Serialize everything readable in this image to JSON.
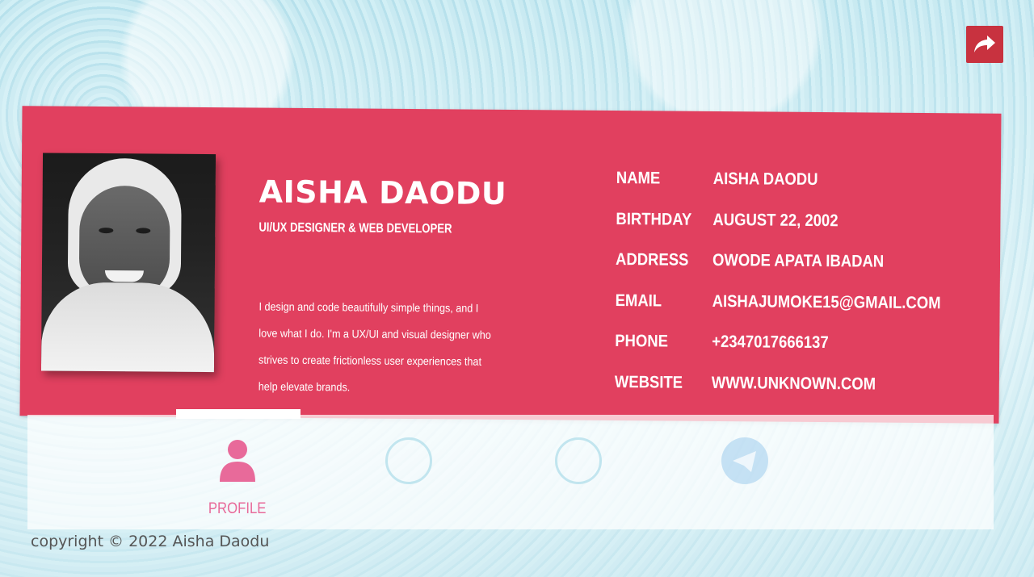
{
  "profile": {
    "name": "AISHA DAODU",
    "title": "UI/UX DESIGNER & WEB DEVELOPER",
    "bio_lines": [
      "I design and code beautifully simple things, and I",
      "love what I do. I'm a UX/UI and visual designer who",
      "strives to create frictionless user experiences that",
      "help elevate brands."
    ]
  },
  "info": [
    {
      "label": "NAME",
      "value": "AISHA DAODU"
    },
    {
      "label": "BIRTHDAY",
      "value": "AUGUST 22, 2002"
    },
    {
      "label": "ADDRESS",
      "value": "OWODE APATA IBADAN"
    },
    {
      "label": "EMAIL",
      "value": "AISHAJUMOKE15@GMAIL.COM"
    },
    {
      "label": "PHONE",
      "value": "+2347017666137"
    },
    {
      "label": "WEBSITE",
      "value": "WWW.UNKNOWN.COM"
    }
  ],
  "nav": {
    "items": [
      {
        "label": "PROFILE",
        "icon": "user-icon",
        "active": true
      },
      {
        "label": "",
        "icon": "resume-icon",
        "active": false
      },
      {
        "label": "",
        "icon": "portfolio-icon",
        "active": false
      },
      {
        "label": "",
        "icon": "send-icon",
        "active": false
      }
    ]
  },
  "footer": {
    "copyright": "copyright © 2022 Aisha Daodu"
  },
  "colors": {
    "card": "#e1405f",
    "share": "#c8323f",
    "active_nav": "#e86a9a"
  }
}
